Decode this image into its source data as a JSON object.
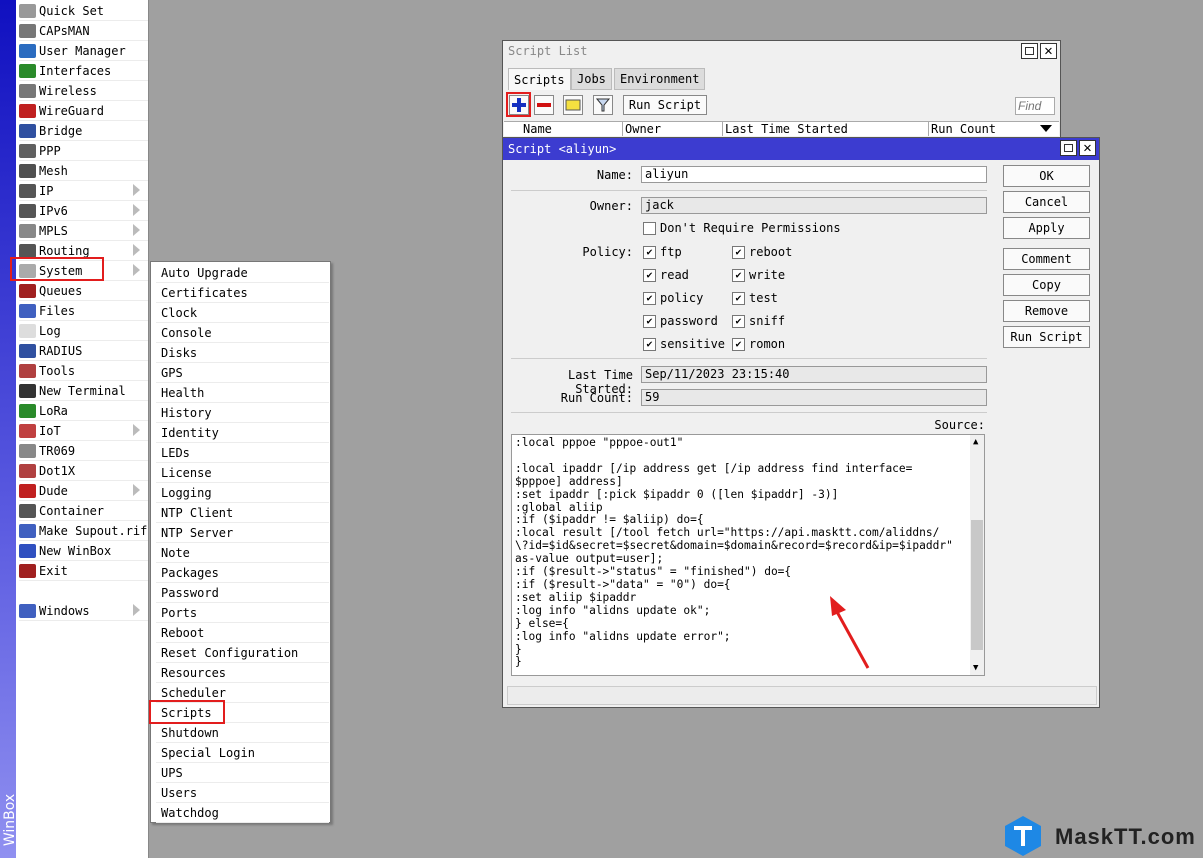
{
  "app": {
    "name": "WinBox"
  },
  "sidebar": {
    "items": [
      {
        "label": "Quick Set",
        "icon": "quick-set-icon"
      },
      {
        "label": "CAPsMAN",
        "icon": "capsman-icon"
      },
      {
        "label": "User Manager",
        "icon": "user-manager-icon"
      },
      {
        "label": "Interfaces",
        "icon": "interfaces-icon"
      },
      {
        "label": "Wireless",
        "icon": "wireless-icon"
      },
      {
        "label": "WireGuard",
        "icon": "wireguard-icon"
      },
      {
        "label": "Bridge",
        "icon": "bridge-icon"
      },
      {
        "label": "PPP",
        "icon": "ppp-icon"
      },
      {
        "label": "Mesh",
        "icon": "mesh-icon"
      },
      {
        "label": "IP",
        "icon": "ip-icon"
      },
      {
        "label": "IPv6",
        "icon": "ipv6-icon"
      },
      {
        "label": "MPLS",
        "icon": "mpls-icon"
      },
      {
        "label": "Routing",
        "icon": "routing-icon"
      },
      {
        "label": "System",
        "icon": "gear-icon"
      },
      {
        "label": "Queues",
        "icon": "queues-icon"
      },
      {
        "label": "Files",
        "icon": "folder-icon"
      },
      {
        "label": "Log",
        "icon": "log-icon"
      },
      {
        "label": "RADIUS",
        "icon": "radius-icon"
      },
      {
        "label": "Tools",
        "icon": "tools-icon"
      },
      {
        "label": "New Terminal",
        "icon": "terminal-icon"
      },
      {
        "label": "LoRa",
        "icon": "lora-icon"
      },
      {
        "label": "IoT",
        "icon": "iot-icon"
      },
      {
        "label": "TR069",
        "icon": "tr069-icon"
      },
      {
        "label": "Dot1X",
        "icon": "dot1x-icon"
      },
      {
        "label": "Dude",
        "icon": "dude-icon"
      },
      {
        "label": "Container",
        "icon": "container-icon"
      },
      {
        "label": "Make Supout.rif",
        "icon": "supout-icon"
      },
      {
        "label": "New WinBox",
        "icon": "winbox-icon"
      },
      {
        "label": "Exit",
        "icon": "exit-icon"
      },
      {
        "label": "Windows",
        "icon": "windows-icon"
      }
    ]
  },
  "system_menu": {
    "items": [
      "Auto Upgrade",
      "Certificates",
      "Clock",
      "Console",
      "Disks",
      "GPS",
      "Health",
      "History",
      "Identity",
      "LEDs",
      "License",
      "Logging",
      "NTP Client",
      "NTP Server",
      "Note",
      "Packages",
      "Password",
      "Ports",
      "Reboot",
      "Reset Configuration",
      "Resources",
      "Scheduler",
      "Scripts",
      "Shutdown",
      "Special Login",
      "UPS",
      "Users",
      "Watchdog"
    ]
  },
  "script_list": {
    "title": "Script List",
    "tabs": [
      "Scripts",
      "Jobs",
      "Environment"
    ],
    "run_script": "Run Script",
    "find_placeholder": "Find",
    "columns": [
      "Name",
      "Owner",
      "Last Time Started",
      "Run Count"
    ]
  },
  "script_editor": {
    "title": "Script <aliyun>",
    "name_label": "Name:",
    "name_value": "aliyun",
    "owner_label": "Owner:",
    "owner_value": "jack",
    "dont_require": "Don't Require Permissions",
    "policy_label": "Policy:",
    "policies": [
      "ftp",
      "reboot",
      "read",
      "write",
      "policy",
      "test",
      "password",
      "sniff",
      "sensitive",
      "romon"
    ],
    "last_started_label": "Last Time Started:",
    "last_started_value": "Sep/11/2023 23:15:40",
    "run_count_label": "Run Count:",
    "run_count_value": "59",
    "source_label": "Source:",
    "buttons": [
      "OK",
      "Cancel",
      "Apply",
      "Comment",
      "Copy",
      "Remove",
      "Run Script"
    ],
    "source": ":local pppoe \"pppoe-out1\"\n\n:local ipaddr [/ip address get [/ip address find interface=\n$pppoe] address]\n:set ipaddr [:pick $ipaddr 0 ([len $ipaddr] -3)]\n:global aliip\n:if ($ipaddr != $aliip) do={\n:local result [/tool fetch url=\"https://api.masktt.com/aliddns/\n\\?id=$id&secret=$secret&domain=$domain&record=$record&ip=$ipaddr\"\nas-value output=user];\n:if ($result->\"status\" = \"finished\") do={\n:if ($result->\"data\" = \"0\") do={\n:set aliip $ipaddr\n:log info \"alidns update ok\";\n} else={\n:log info \"alidns update error\";\n}\n}"
  },
  "watermark": {
    "text": "MaskTT.com",
    "colors": {
      "accent": "#1e88e5"
    }
  }
}
